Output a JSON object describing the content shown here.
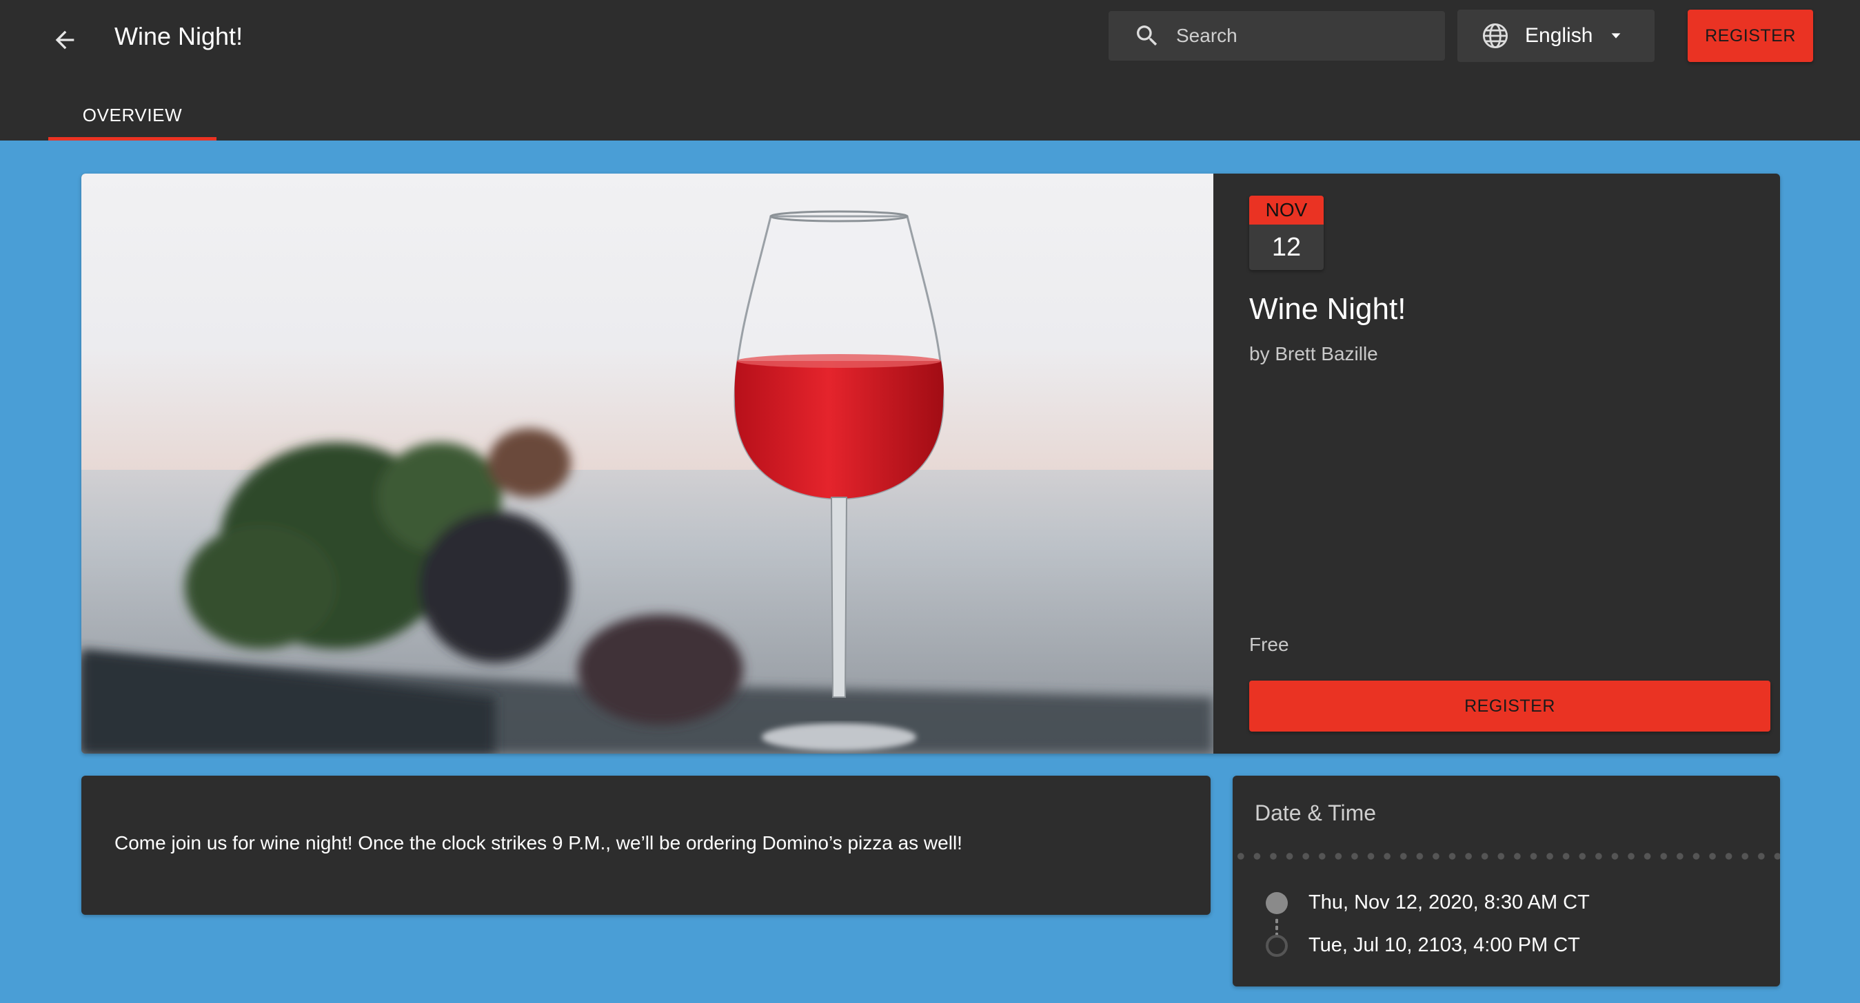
{
  "header": {
    "title": "Wine Night!",
    "search_placeholder": "Search",
    "language": "English",
    "register_label": "REGISTER",
    "tabs": [
      {
        "label": "OVERVIEW",
        "active": true
      }
    ]
  },
  "event": {
    "month": "NOV",
    "day": "12",
    "title": "Wine Night!",
    "organizer": "by Brett Bazille",
    "price": "Free",
    "register_label": "REGISTER",
    "description": "Come join us for wine night! Once the clock strikes 9 P.M., we’ll be ordering Domino’s pizza as well!"
  },
  "date_time": {
    "title": "Date & Time",
    "start": "Thu, Nov 12, 2020, 8:30 AM CT",
    "end": "Tue, Jul 10, 2103, 4:00 PM CT"
  },
  "colors": {
    "accent": "#ea3323",
    "page_background": "#4a9ed6",
    "card_background": "#2d2d2d"
  },
  "icons": [
    "back-arrow-icon",
    "search-icon",
    "globe-icon",
    "caret-down-icon"
  ]
}
